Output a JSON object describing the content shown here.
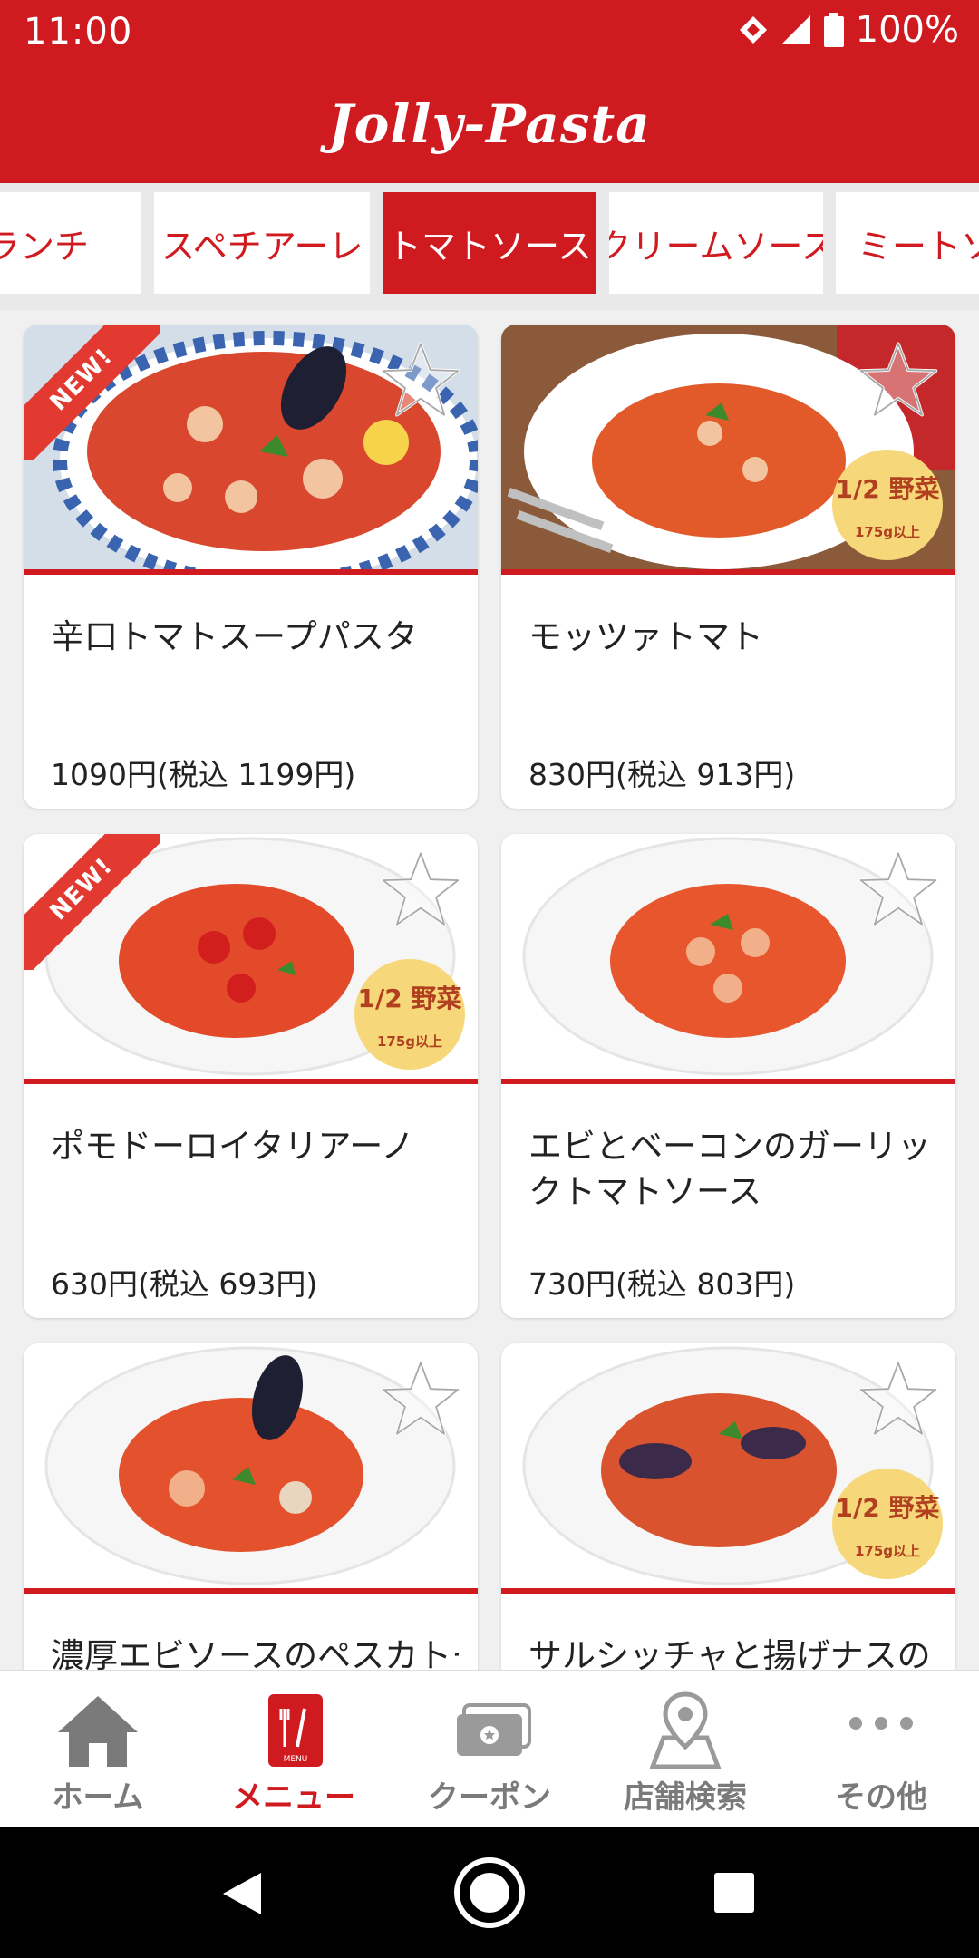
{
  "status_bar": {
    "time": "11:00",
    "battery": "100%"
  },
  "header": {
    "logo_text": "Jolly-Pasta"
  },
  "tabs": [
    {
      "label": "ランチ",
      "active": false
    },
    {
      "label": "スペチアーレ",
      "active": false
    },
    {
      "label": "トマトソース",
      "active": true
    },
    {
      "label": "クリームソース",
      "active": false
    },
    {
      "label": "ミートソース",
      "active": false
    }
  ],
  "items": [
    {
      "name": "辛口トマトスープパスタ",
      "price": "1090円(税込 1199円)",
      "new": true,
      "veg": false
    },
    {
      "name": "モッツァトマト",
      "price": "830円(税込 913円)",
      "new": false,
      "veg": true
    },
    {
      "name": "ポモドーロイタリアーノ",
      "price": "630円(税込 693円)",
      "new": true,
      "veg": true
    },
    {
      "name": "エビとベーコンのガーリックトマトソース",
      "price": "730円(税込 803円)",
      "new": false,
      "veg": false
    },
    {
      "name": "濃厚エビソースのペスカトーレ",
      "price": "",
      "new": false,
      "veg": false
    },
    {
      "name": "サルシッチャと揚げナスのトマトソース",
      "price": "",
      "new": false,
      "veg": true
    }
  ],
  "badges": {
    "new_label": "NEW!",
    "veg_main": "1/2 野菜",
    "veg_sub": "175g以上"
  },
  "bottom_nav": [
    {
      "label": "ホーム",
      "icon": "home-icon"
    },
    {
      "label": "メニュー",
      "icon": "menu-icon"
    },
    {
      "label": "クーポン",
      "icon": "coupon-icon"
    },
    {
      "label": "店舗検索",
      "icon": "store-search-icon"
    },
    {
      "label": "その他",
      "icon": "more-icon"
    }
  ],
  "colors": {
    "brand_red": "#cf1a20",
    "nav_gray": "#7a7a7a"
  }
}
